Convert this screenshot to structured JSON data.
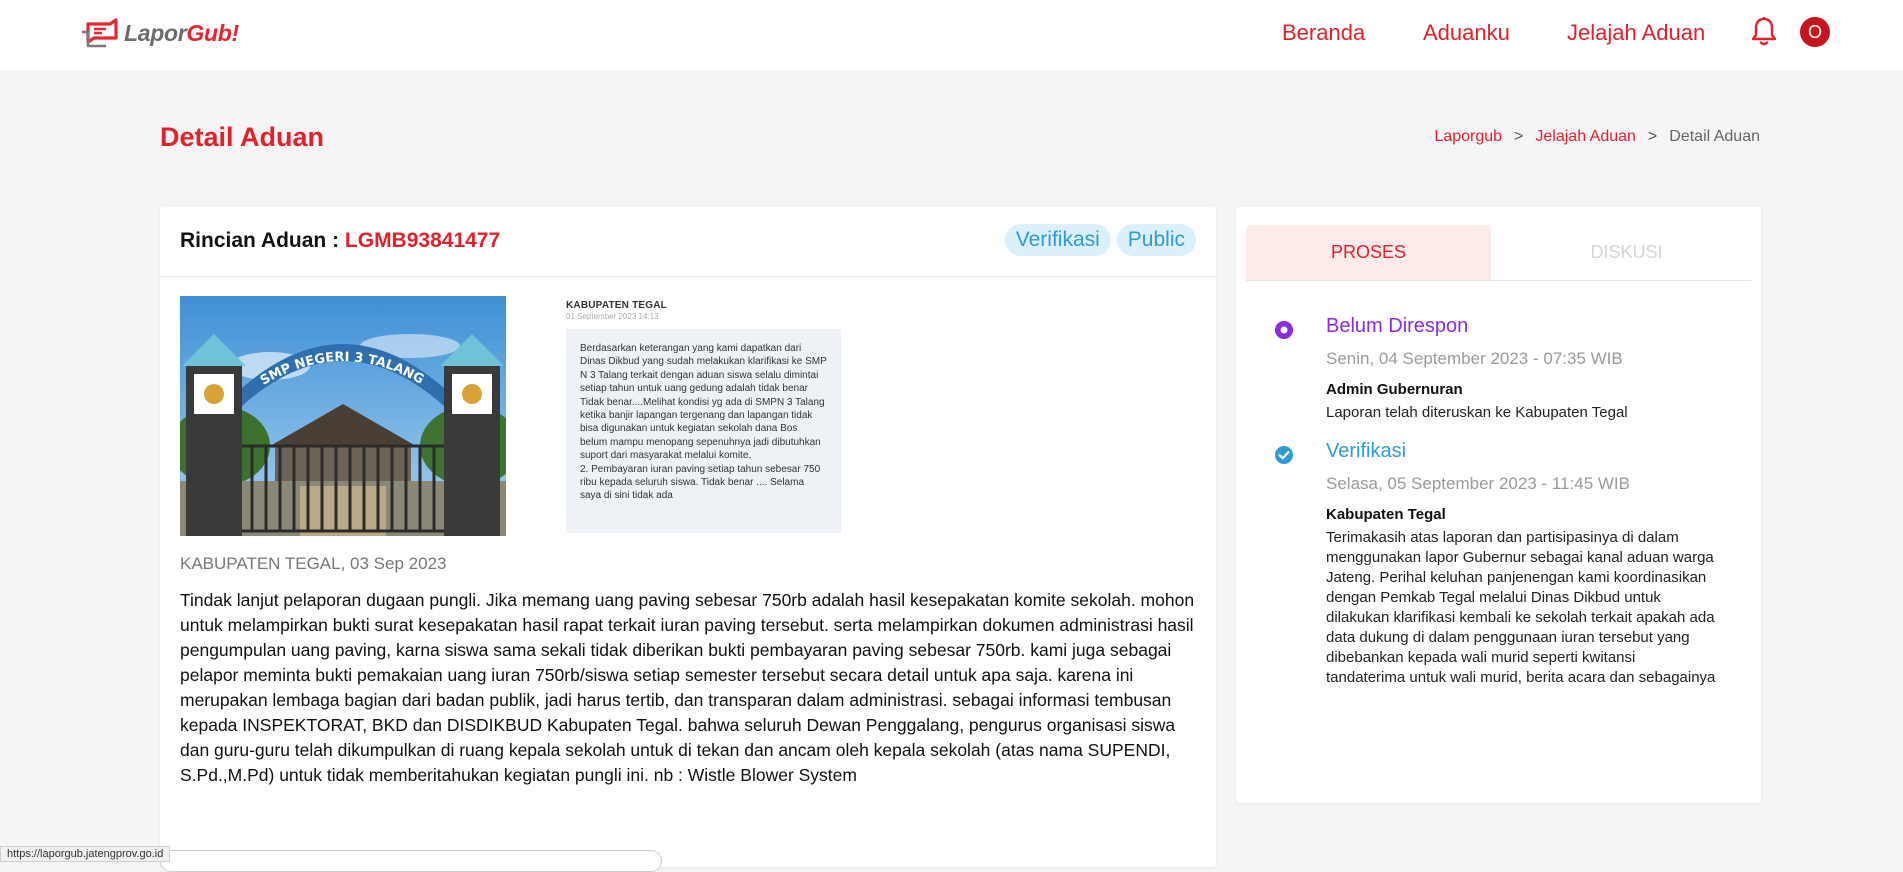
{
  "brand": {
    "part1": "Lapor",
    "part2": "Gub!"
  },
  "nav": {
    "items": [
      "Beranda",
      "Aduanku",
      "Jelajah Aduan"
    ],
    "avatar_initial": "O"
  },
  "page": {
    "title": "Detail Aduan",
    "breadcrumb": [
      "Laporgub",
      "Jelajah Aduan",
      "Detail Aduan"
    ]
  },
  "complaint": {
    "label": "Rincian Aduan : ",
    "id": "LGMB93841477",
    "badges": [
      "Verifikasi",
      "Public"
    ],
    "photo_sign_text": "SMP NEGERI 3 TALANG",
    "attachment": {
      "title": "KABUPATEN TEGAL",
      "date": "01 September 2023 14:13",
      "body": "Berdasarkan keterangan yang kami dapatkan dari Dinas Dikbud yang sudah melakukan klarifikasi ke SMP N 3 Talang terkait dengan aduan siswa selalu dimintai setiap tahun untuk uang gedung adalah tidak benar Tidak benar....Melihat kondisi yg ada  di SMPN 3 Talang ketika banjir lapangan tergenang dan lapangan tidak bisa digunakan untuk kegiatan sekolah dana Bos belum  mampu menopang sepenuhnya jadi dibutuhkan suport dari masyarakat melalui komite.\n2. Pembayaran iuran paving setiap tahun sebesar 750 ribu kepada seluruh siswa. Tidak benar .... Selama saya di sini tidak ada"
    },
    "location_date": "KABUPATEN TEGAL, 03 Sep 2023",
    "description": "Tindak lanjut pelaporan dugaan pungli. Jika memang uang paving sebesar 750rb adalah hasil kesepakatan komite sekolah. mohon untuk melampirkan bukti surat kesepakatan hasil rapat terkait iuran paving tersebut. serta melampirkan dokumen administrasi hasil pengumpulan uang paving, karna siswa sama sekali tidak diberikan bukti pembayaran paving sebesar 750rb. kami juga sebagai pelapor meminta bukti pemakaian uang iuran 750rb/siswa setiap semester tersebut secara detail untuk apa saja. karena ini merupakan lembaga bagian dari badan publik, jadi harus tertib, dan transparan dalam administrasi. sebagai informasi tembusan kepada INSPEKTORAT, BKD dan DISDIKBUD Kabupaten Tegal. bahwa seluruh Dewan Penggalang, pengurus organisasi siswa dan guru-guru telah dikumpulkan di ruang kepala sekolah untuk di tekan dan ancam oleh kepala sekolah (atas nama SUPENDI, S.Pd.,M.Pd) untuk tidak memberitahukan kegiatan pungli ini. nb : Wistle Blower System"
  },
  "process": {
    "tabs": [
      "PROSES",
      "DISKUSI"
    ],
    "timeline": [
      {
        "status": "Belum Direspon",
        "date": "Senin, 04 September 2023 - 07:35 WIB",
        "author": "Admin Gubernuran",
        "note": "Laporan telah diteruskan ke Kabupaten Tegal",
        "color": "#8a2be2"
      },
      {
        "status": "Verifikasi",
        "date": "Selasa, 05 September 2023 - 11:45 WIB",
        "author": "Kabupaten Tegal",
        "note": "Terimakasih atas laporan dan partisipasinya di dalam menggunakan lapor Gubernur sebagai kanal aduan warga Jateng. Perihal keluhan panjenengan kami koordinasikan dengan Pemkab Tegal melalui Dinas Dikbud untuk dilakukan klarifikasi kembali ke sekolah terkait  apakah ada data dukung di dalam penggunaan iuran tersebut yang dibebankan kepada wali murid seperti kwitansi tandaterima untuk wali murid, berita acara dan sebagainya",
        "color": "#2d9bd6"
      }
    ]
  },
  "browser_status": {
    "url": "https://laporgub.jatengprov.go.id"
  },
  "colors": {
    "brand_red": "#e0222a",
    "badge_blue": "#2d9bd6",
    "purple": "#8a2be2"
  }
}
